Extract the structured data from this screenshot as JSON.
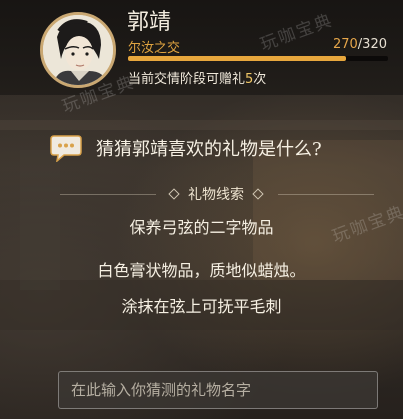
{
  "character": {
    "name": "郭靖",
    "relation_level": "尔汝之交",
    "affinity_current": "270",
    "affinity_separator": "/",
    "affinity_max": "320",
    "affinity_fraction": 0.84,
    "gift_info_prefix": "当前交情阶段可赠礼",
    "gift_count": "5",
    "gift_info_suffix": "次"
  },
  "guess": {
    "question": "猜猜郭靖喜欢的礼物是什么?",
    "clue_title": "礼物线索",
    "clues": [
      "保养弓弦的二字物品",
      "白色膏状物品，质地似蜡烛。",
      "涂抹在弦上可抚平毛刺"
    ],
    "input_placeholder": "在此输入你猜测的礼物名字"
  },
  "watermark": [
    "玩咖宝典",
    "玩咖宝典",
    "玩咖宝典"
  ],
  "colors": {
    "accent": "#e7a73d",
    "relation": "#e0a440",
    "avatar_border": "#caa872"
  },
  "icons": {
    "chat": "speech-bubble-icon",
    "diamond": "diamond-ornament-icon"
  }
}
